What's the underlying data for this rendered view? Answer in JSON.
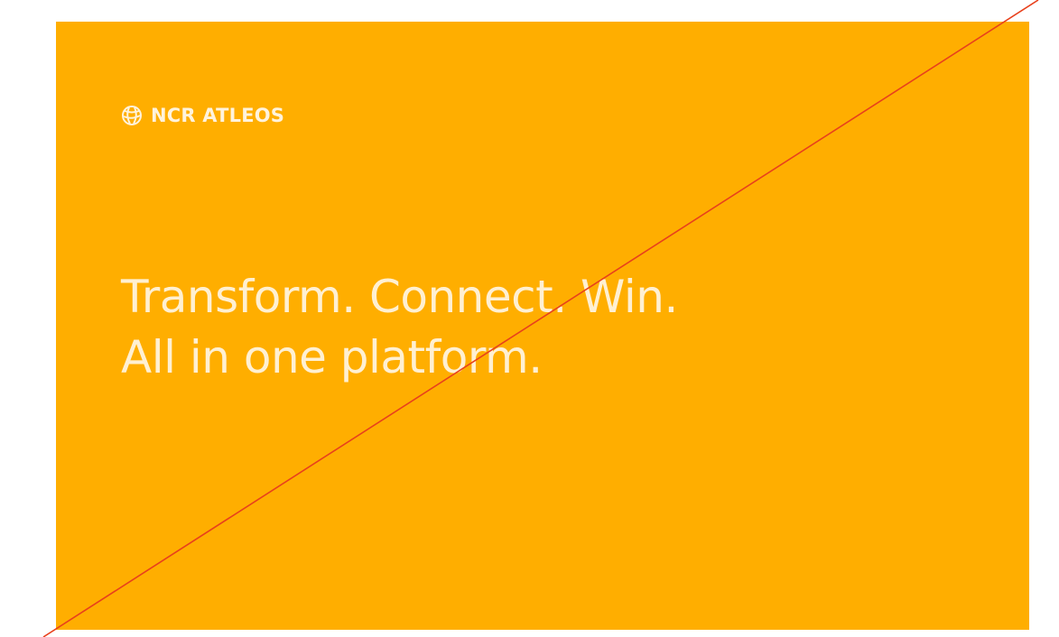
{
  "colors": {
    "banner_background": "#ffae00",
    "text": "#fff0d2",
    "strike_line": "#e8401c",
    "page_background": "#ffffff"
  },
  "brand": {
    "icon": "globe-icon",
    "name": "NCR ATLEOS"
  },
  "headline": {
    "line1": "Transform. Connect. Win.",
    "line2": "All in one platform."
  },
  "overlay": {
    "type": "diagonal-strike-line"
  }
}
